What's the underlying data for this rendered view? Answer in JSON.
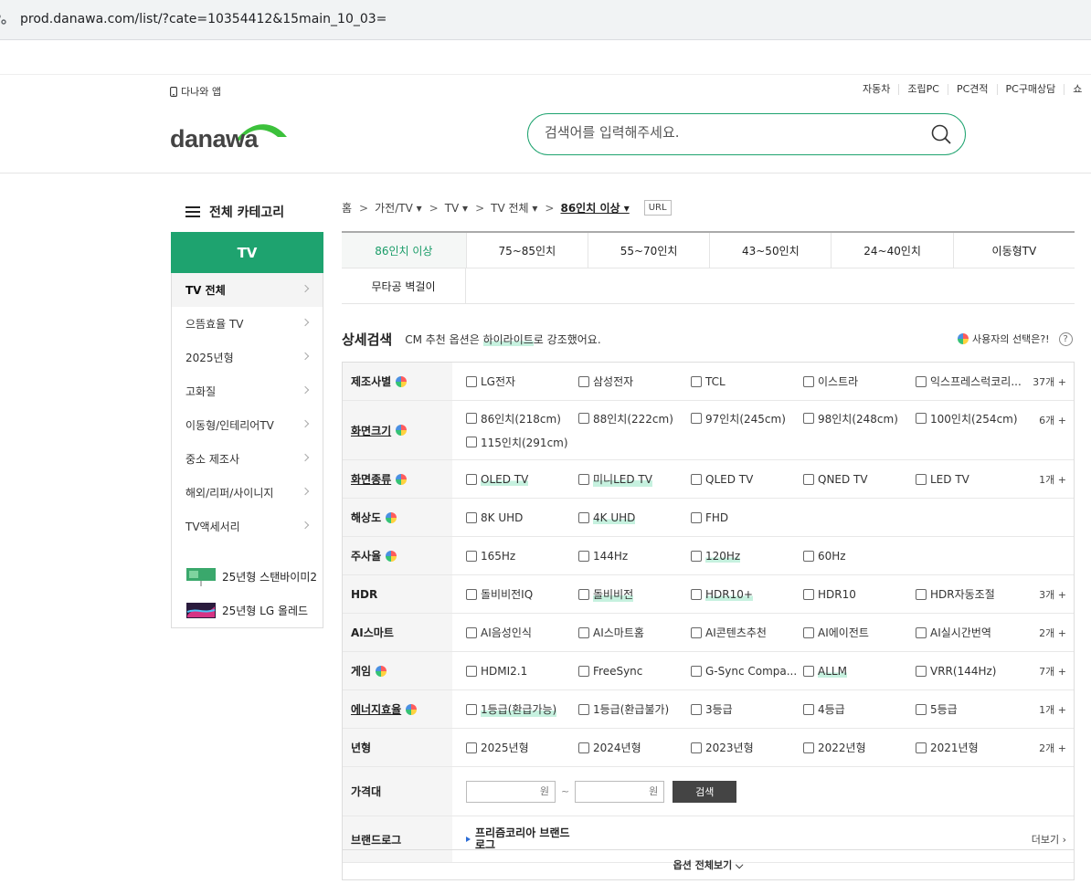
{
  "browser": {
    "url": "prod.danawa.com/list/?cate=10354412&15main_10_03="
  },
  "header": {
    "app_link": "다나와 앱",
    "topnav": [
      "자동차",
      "조립PC",
      "PC견적",
      "PC구매상담",
      "쇼"
    ],
    "logo_text": "danawa",
    "search_placeholder": "검색어를 입력해주세요."
  },
  "sidebar": {
    "title": "전체 카테고리",
    "head": "TV",
    "items": [
      "TV 전체",
      "으뜸효율 TV",
      "2025년형",
      "고화질",
      "이동형/인테리어TV",
      "중소 제조사",
      "해외/리퍼/사이니지",
      "TV액세서리"
    ],
    "promos": [
      "25년형 스탠바이미2",
      "25년형 LG 올레드"
    ]
  },
  "breadcrumb": {
    "home": "홈",
    "items": [
      "가전/TV ▾",
      "TV ▾",
      "TV 전체 ▾"
    ],
    "current": "86인치 이상 ▾",
    "url_button": "URL"
  },
  "tabs": {
    "row1": [
      "86인치 이상",
      "75~85인치",
      "55~70인치",
      "43~50인치",
      "24~40인치",
      "이동형TV"
    ],
    "row2": [
      "무타공 벽걸이"
    ]
  },
  "detail": {
    "title": "상세검색",
    "subtitle_pre": "CM 추천 옵션은 ",
    "subtitle_hl": "하이라이트",
    "subtitle_post": "로 강조했어요.",
    "user_choice": "사용자의 선택은?!",
    "help": "?"
  },
  "spec": {
    "rows": [
      {
        "label": "제조사별",
        "dot": true,
        "ul": false,
        "more": "37개 +",
        "opts": [
          [
            "LG전자",
            false
          ],
          [
            "삼성전자",
            false
          ],
          [
            "TCL",
            false
          ],
          [
            "이스트라",
            false
          ],
          [
            "익스프레스럭코리...",
            false
          ]
        ]
      },
      {
        "label": "화면크기",
        "dot": true,
        "ul": true,
        "more": "6개 +",
        "tall": true,
        "opts": [
          [
            "86인치(218cm)",
            false
          ],
          [
            "88인치(222cm)",
            false
          ],
          [
            "97인치(245cm)",
            false
          ],
          [
            "98인치(248cm)",
            false
          ],
          [
            "100인치(254cm)",
            false
          ],
          [
            "115인치(291cm)",
            false
          ]
        ]
      },
      {
        "label": "화면종류",
        "dot": true,
        "ul": true,
        "more": "1개 +",
        "opts": [
          [
            "OLED TV",
            true
          ],
          [
            "미니LED TV",
            true
          ],
          [
            "QLED TV",
            false
          ],
          [
            "QNED TV",
            false
          ],
          [
            "LED TV",
            false
          ]
        ]
      },
      {
        "label": "해상도",
        "dot": true,
        "ul": false,
        "more": "",
        "opts": [
          [
            "8K UHD",
            false
          ],
          [
            "4K UHD",
            true
          ],
          [
            "FHD",
            false
          ]
        ]
      },
      {
        "label": "주사율",
        "dot": true,
        "ul": false,
        "more": "",
        "opts": [
          [
            "165Hz",
            false
          ],
          [
            "144Hz",
            false
          ],
          [
            "120Hz",
            true
          ],
          [
            "60Hz",
            false
          ]
        ]
      },
      {
        "label": "HDR",
        "dot": false,
        "ul": false,
        "more": "3개 +",
        "opts": [
          [
            "돌비비전IQ",
            false
          ],
          [
            "돌비비전",
            true
          ],
          [
            "HDR10+",
            true
          ],
          [
            "HDR10",
            false
          ],
          [
            "HDR자동조절",
            false
          ]
        ]
      },
      {
        "label": "AI스마트",
        "dot": false,
        "ul": false,
        "more": "2개 +",
        "opts": [
          [
            "AI음성인식",
            false
          ],
          [
            "AI스마트홈",
            false
          ],
          [
            "AI콘텐츠추천",
            false
          ],
          [
            "AI에이전트",
            false
          ],
          [
            "AI실시간번역",
            false
          ]
        ]
      },
      {
        "label": "게임",
        "dot": true,
        "ul": false,
        "more": "7개 +",
        "opts": [
          [
            "HDMI2.1",
            false
          ],
          [
            "FreeSync",
            false
          ],
          [
            "G-Sync Compa...",
            false
          ],
          [
            "ALLM",
            true
          ],
          [
            "VRR(144Hz)",
            false
          ]
        ]
      },
      {
        "label": "에너지효율",
        "dot": true,
        "ul": true,
        "more": "1개 +",
        "opts": [
          [
            "1등급(환급가능)",
            true
          ],
          [
            "1등급(환급불가)",
            false
          ],
          [
            "3등급",
            false
          ],
          [
            "4등급",
            false
          ],
          [
            "5등급",
            false
          ]
        ]
      },
      {
        "label": "년형",
        "dot": false,
        "ul": false,
        "more": "2개 +",
        "opts": [
          [
            "2025년형",
            false
          ],
          [
            "2024년형",
            false
          ],
          [
            "2023년형",
            false
          ],
          [
            "2022년형",
            false
          ],
          [
            "2021년형",
            false
          ]
        ]
      }
    ],
    "price": {
      "label": "가격대",
      "won": "원",
      "tilde": "~",
      "button": "검색"
    },
    "brand": {
      "label": "브랜드로그",
      "link": "프리즘코리아 브랜드 로그",
      "more": "더보기 ›"
    },
    "view_all": "옵션 전체보기 ⌵"
  }
}
